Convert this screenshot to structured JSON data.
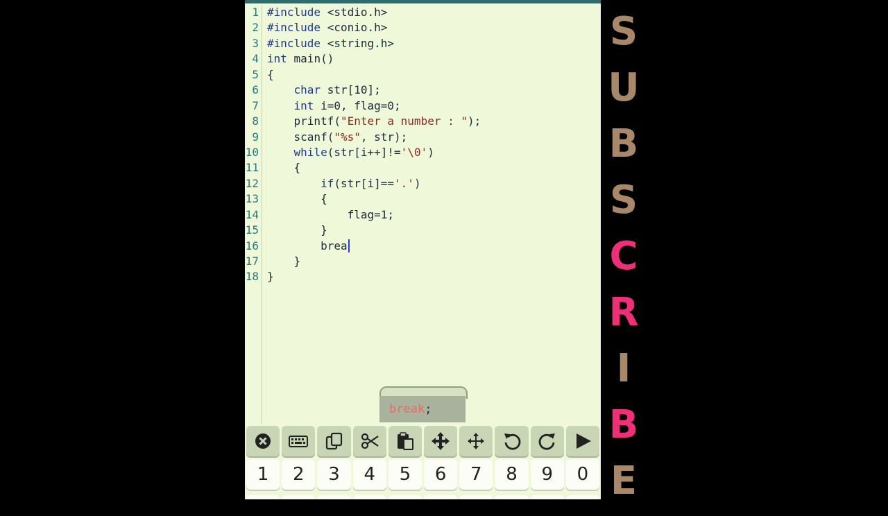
{
  "editor": {
    "lines": [
      {
        "n": "1",
        "html": "<span class=\"kw\">#include</span> &lt;stdio.h&gt;"
      },
      {
        "n": "2",
        "html": "<span class=\"kw\">#include</span> &lt;conio.h&gt;"
      },
      {
        "n": "3",
        "html": "<span class=\"kw\">#include</span> &lt;string.h&gt;"
      },
      {
        "n": "4",
        "html": "<span class=\"kw\">int</span> main()"
      },
      {
        "n": "5",
        "html": "{"
      },
      {
        "n": "6",
        "html": "    <span class=\"kw\">char</span> str[10];"
      },
      {
        "n": "7",
        "html": "    <span class=\"kw\">int</span> i=0, flag=0;"
      },
      {
        "n": "8",
        "html": "    printf(<span class=\"str\">\"Enter a number : \"</span>);"
      },
      {
        "n": "9",
        "html": "    scanf(<span class=\"str\">\"%s\"</span>, str);"
      },
      {
        "n": "10",
        "html": "    <span class=\"kw\">while</span>(str[i++]!=<span class=\"str\">'\\0'</span>)"
      },
      {
        "n": "11",
        "html": "    {"
      },
      {
        "n": "12",
        "html": "        <span class=\"kw\">if</span>(str[i]==<span class=\"str\">'.'</span>)"
      },
      {
        "n": "13",
        "html": "        {"
      },
      {
        "n": "14",
        "html": "            flag=1;"
      },
      {
        "n": "15",
        "html": "        }"
      },
      {
        "n": "16",
        "html": "        brea<span class=\"cursor\"></span>"
      },
      {
        "n": "17",
        "html": "    }"
      },
      {
        "n": "18",
        "html": "}"
      }
    ]
  },
  "autocomplete": {
    "match": "break",
    "rest": ";"
  },
  "toolbar": {
    "buttons": [
      "close-icon",
      "keyboard-icon",
      "copy-icon",
      "cut-icon",
      "paste-icon",
      "move-select-icon",
      "move-cursor-icon",
      "undo-icon",
      "redo-icon",
      "run-icon"
    ]
  },
  "number_row": {
    "keys": [
      "1",
      "2",
      "3",
      "4",
      "5",
      "6",
      "7",
      "8",
      "9",
      "0"
    ]
  },
  "overlay": {
    "letters": [
      "S",
      "U",
      "B",
      "S",
      "C",
      "R",
      "I",
      "B",
      "E"
    ],
    "colors": [
      "#a88869",
      "#a88869",
      "#a88869",
      "#a88869",
      "#ef2f78",
      "#ef2f78",
      "#a88869",
      "#ef2f78",
      "#a88869"
    ]
  },
  "colors": {
    "editor_bg": "#eff8d9",
    "keyword": "#1b3a8c",
    "string": "#8b2a22",
    "line_number": "#1e7d7d",
    "cursor": "#1a3cff"
  }
}
